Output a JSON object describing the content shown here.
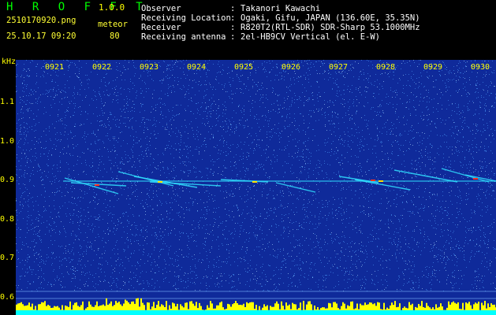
{
  "header": {
    "app_name": "H R O F F T",
    "version": "1.0.0",
    "filename": "2510170920.png",
    "timestamp": "25.10.17 09:20",
    "detection_label": "meteor",
    "detection_count": "80",
    "info_labels": [
      "Observer",
      "Receiving Location",
      "Receiver",
      "Receiving antenna"
    ],
    "info_separator": ":",
    "info_values": [
      "Takanori Kawachi",
      "Ogaki, Gifu, JAPAN (136.60E, 35.35N)",
      "R820T2(RTL-SDR) SDR-Sharp 53.1000MHz",
      "2el-HB9CV Vertical (el. E-W)"
    ]
  },
  "spectrogram": {
    "y_unit": "kHz",
    "y_ticks": [
      "1.1",
      "1.0",
      "0.9",
      "0.8",
      "0.7",
      "0.6"
    ],
    "x_ticks": [
      "0921",
      "0922",
      "0923",
      "0924",
      "0925",
      "0926",
      "0927",
      "0928",
      "0929",
      "0930"
    ],
    "colors": {
      "background": "#0f2a9a",
      "noise": "#4fa0ff",
      "trace": "#30e0ff",
      "hot": "#ff3020",
      "warm": "#ffe000",
      "floor": "#ffff00",
      "floor_base": "#00ffff"
    }
  }
}
